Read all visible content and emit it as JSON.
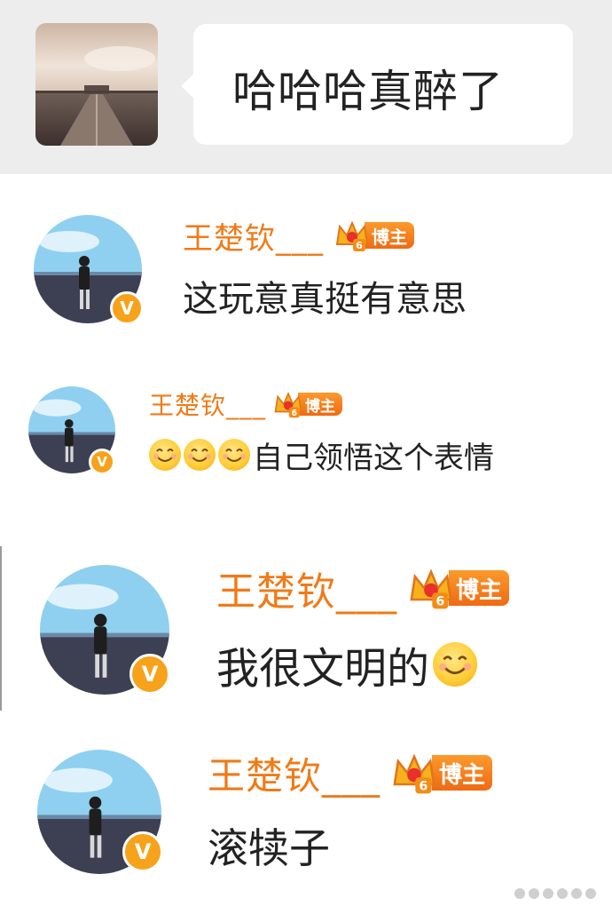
{
  "top_message": {
    "text": "哈哈哈真醉了",
    "avatar_icon": "road-photo-avatar"
  },
  "comments": [
    {
      "username": "王楚钦___",
      "badge_level": "6",
      "badge_label": "博主",
      "text": "这玩意真挺有意思",
      "emoji_before_text": 0,
      "emoji_after_text": 0,
      "verified_mark": "V"
    },
    {
      "username": "王楚钦___",
      "badge_level": "6",
      "badge_label": "博主",
      "text": "自己领悟这个表情",
      "emoji_before_text": 3,
      "emoji_after_text": 0,
      "verified_mark": "V"
    },
    {
      "username": "王楚钦___",
      "badge_level": "6",
      "badge_label": "博主",
      "text": "我很文明的",
      "emoji_before_text": 0,
      "emoji_after_text": 1,
      "verified_mark": "V"
    },
    {
      "username": "王楚钦___",
      "badge_level": "6",
      "badge_label": "博主",
      "text": "滚犊子",
      "emoji_before_text": 0,
      "emoji_after_text": 0,
      "verified_mark": "V"
    }
  ],
  "colors": {
    "username": "#f07a17",
    "badge": "#ef6a14",
    "verified": "#f7a21b",
    "top_background": "#ededed"
  }
}
